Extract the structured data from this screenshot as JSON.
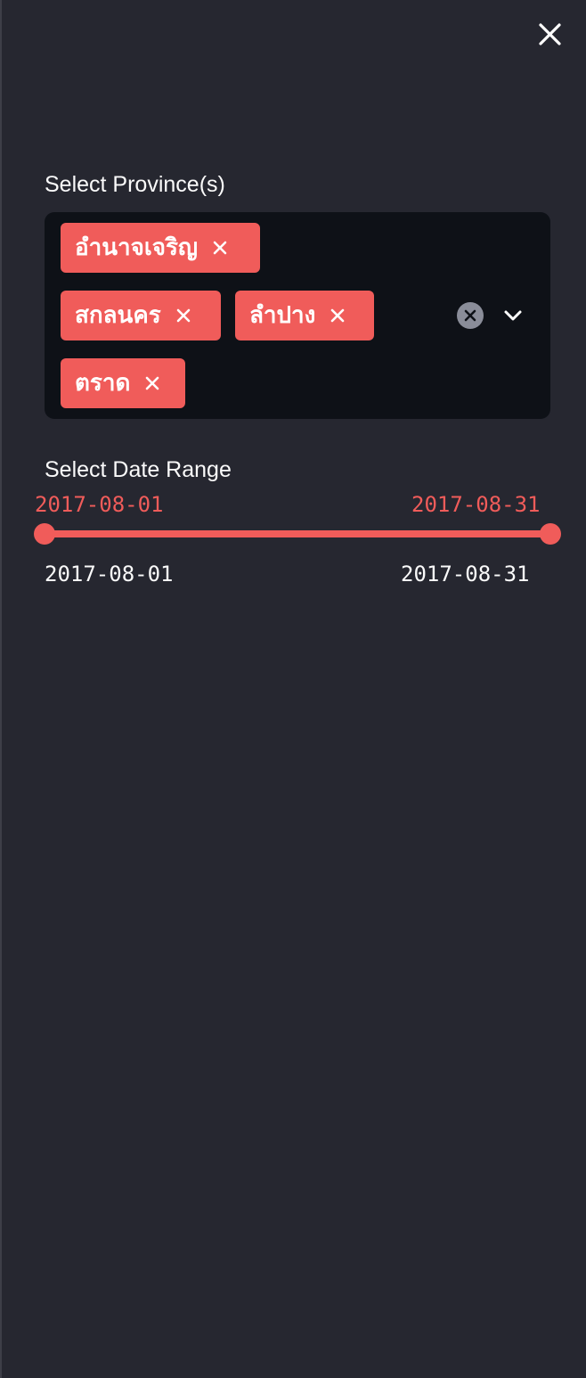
{
  "sidebar": {
    "close_icon": "close-icon"
  },
  "province_select": {
    "label": "Select Province(s)",
    "selected": [
      {
        "label": "อำนาจเจริญ"
      },
      {
        "label": "สกลนคร"
      },
      {
        "label": "ลำปาง"
      },
      {
        "label": "ตราด"
      }
    ],
    "tag_remove_icon": "close-icon",
    "clear_all_icon": "clear-circle-icon",
    "dropdown_icon": "chevron-down-icon"
  },
  "date_range": {
    "label": "Select Date Range",
    "value_start": "2017-08-01",
    "value_end": "2017-08-31",
    "min": "2017-08-01",
    "max": "2017-08-31"
  },
  "colors": {
    "background": "#262730",
    "input_background": "#0e1117",
    "accent": "#f05c5a",
    "text": "#fafafa"
  }
}
